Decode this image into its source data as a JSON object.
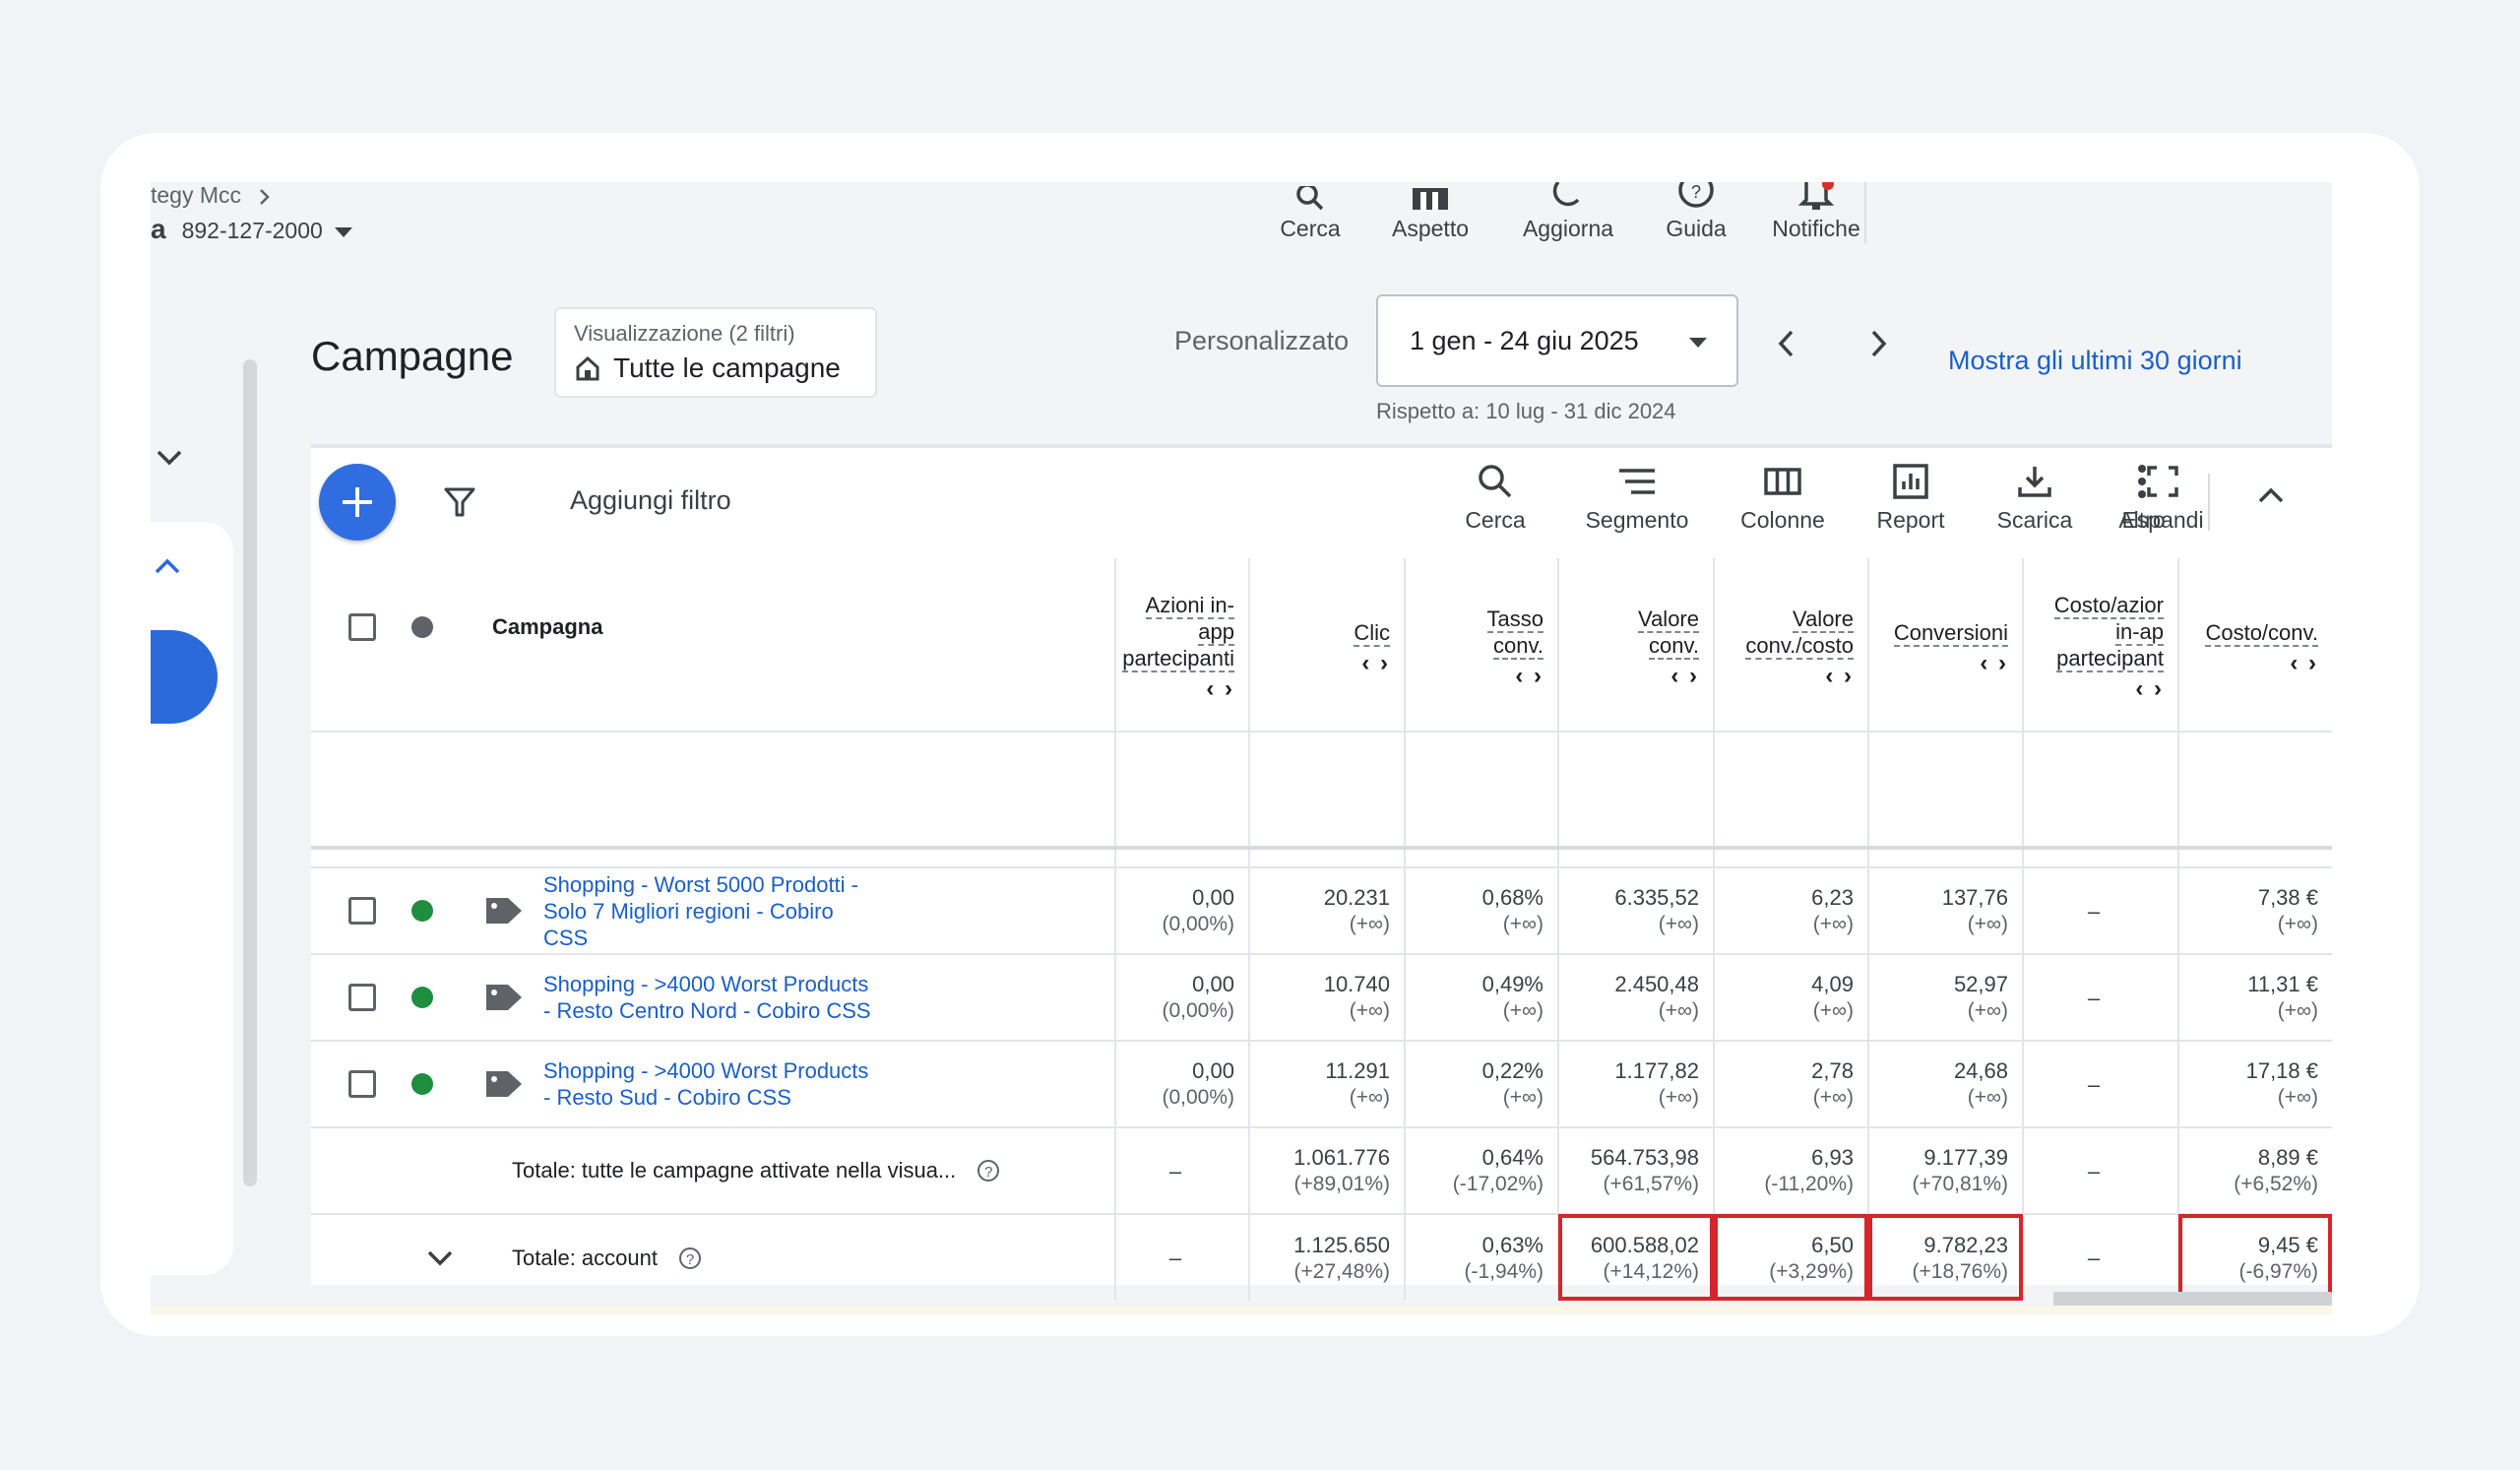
{
  "header": {
    "breadcrumb": "tegy Mcc",
    "account_prefix": "a",
    "account_id": "892-127-2000",
    "top_actions": [
      {
        "label": "Cerca",
        "icon": "search-icon"
      },
      {
        "label": "Aspetto",
        "icon": "appearance-icon"
      },
      {
        "label": "Aggiorna",
        "icon": "refresh-icon"
      },
      {
        "label": "Guida",
        "icon": "help-icon"
      },
      {
        "label": "Notifiche",
        "icon": "bell-icon"
      }
    ]
  },
  "page": {
    "title": "Campagne",
    "view": {
      "caption": "Visualizzazione (2 filtri)",
      "value": "Tutte le campagne"
    },
    "date_mode": "Personalizzato",
    "date_range": "1 gen - 24 giu 2025",
    "compare": "Rispetto a: 10 lug - 31 dic 2024",
    "last30": "Mostra gli ultimi 30 giorni"
  },
  "toolbar": {
    "add_filter": "Aggiungi filtro",
    "buttons": [
      {
        "label": "Cerca",
        "icon": "search-icon"
      },
      {
        "label": "Segmento",
        "icon": "segment-icon"
      },
      {
        "label": "Colonne",
        "icon": "columns-icon"
      },
      {
        "label": "Report",
        "icon": "report-icon"
      },
      {
        "label": "Scarica",
        "icon": "download-icon"
      },
      {
        "label": "Espandi",
        "icon": "expand-icon"
      },
      {
        "label": "Altro",
        "icon": "more-vert-icon"
      }
    ]
  },
  "table": {
    "campaign_header": "Campagna",
    "columns": [
      {
        "l1": "Azioni in-",
        "l2": "app",
        "l3": "partecipanti"
      },
      {
        "l1": "Clic"
      },
      {
        "l1": "Tasso",
        "l2": "conv."
      },
      {
        "l1": "Valore",
        "l2": "conv."
      },
      {
        "l1": "Valore",
        "l2": "conv./costo"
      },
      {
        "l1": "Conversioni"
      },
      {
        "l1": "Costo/azior",
        "l2": "in-ap",
        "l3": "partecipant"
      },
      {
        "l1": "Costo/conv."
      }
    ],
    "sort_arrows": "‹ ›",
    "rows": [
      {
        "name": "Shopping - Worst 5000 Prodotti - Solo 7 Migliori regioni - Cobiro CSS",
        "status_color": "#1e8e3e",
        "cells": [
          {
            "v": "0,00",
            "d": "(0,00%)"
          },
          {
            "v": "20.231",
            "d": "(+∞)"
          },
          {
            "v": "0,68%",
            "d": "(+∞)"
          },
          {
            "v": "6.335,52",
            "d": "(+∞)"
          },
          {
            "v": "6,23",
            "d": "(+∞)"
          },
          {
            "v": "137,76",
            "d": "(+∞)"
          },
          {
            "v": "–",
            "d": ""
          },
          {
            "v": "7,38 €",
            "d": "(+∞)"
          }
        ]
      },
      {
        "name": "Shopping - >4000 Worst Products - Resto Centro Nord - Cobiro CSS",
        "status_color": "#1e8e3e",
        "cells": [
          {
            "v": "0,00",
            "d": "(0,00%)"
          },
          {
            "v": "10.740",
            "d": "(+∞)"
          },
          {
            "v": "0,49%",
            "d": "(+∞)"
          },
          {
            "v": "2.450,48",
            "d": "(+∞)"
          },
          {
            "v": "4,09",
            "d": "(+∞)"
          },
          {
            "v": "52,97",
            "d": "(+∞)"
          },
          {
            "v": "–",
            "d": ""
          },
          {
            "v": "11,31 €",
            "d": "(+∞)"
          }
        ]
      },
      {
        "name": "Shopping - >4000 Worst Products - Resto Sud - Cobiro CSS",
        "status_color": "#1e8e3e",
        "cells": [
          {
            "v": "0,00",
            "d": "(0,00%)"
          },
          {
            "v": "11.291",
            "d": "(+∞)"
          },
          {
            "v": "0,22%",
            "d": "(+∞)"
          },
          {
            "v": "1.177,82",
            "d": "(+∞)"
          },
          {
            "v": "2,78",
            "d": "(+∞)"
          },
          {
            "v": "24,68",
            "d": "(+∞)"
          },
          {
            "v": "–",
            "d": ""
          },
          {
            "v": "17,18 €",
            "d": "(+∞)"
          }
        ]
      }
    ],
    "totals": [
      {
        "label": "Totale: tutte le campagne attivate nella visua...",
        "cells": [
          {
            "v": "–",
            "d": ""
          },
          {
            "v": "1.061.776",
            "d": "(+89,01%)"
          },
          {
            "v": "0,64%",
            "d": "(-17,02%)"
          },
          {
            "v": "564.753,98",
            "d": "(+61,57%)"
          },
          {
            "v": "6,93",
            "d": "(-11,20%)"
          },
          {
            "v": "9.177,39",
            "d": "(+70,81%)"
          },
          {
            "v": "–",
            "d": ""
          },
          {
            "v": "8,89 €",
            "d": "(+6,52%)"
          }
        ]
      },
      {
        "label": "Totale: account",
        "cells": [
          {
            "v": "–",
            "d": ""
          },
          {
            "v": "1.125.650",
            "d": "(+27,48%)"
          },
          {
            "v": "0,63%",
            "d": "(-1,94%)"
          },
          {
            "v": "600.588,02",
            "d": "(+14,12%)"
          },
          {
            "v": "6,50",
            "d": "(+3,29%)"
          },
          {
            "v": "9.782,23",
            "d": "(+18,76%)"
          },
          {
            "v": "–",
            "d": ""
          },
          {
            "v": "9,45 €",
            "d": "(-6,97%)"
          }
        ]
      }
    ]
  },
  "colors": {
    "accent": "#1a5fc8",
    "fab": "#2f6de0",
    "highlight": "#d4262b",
    "status_active": "#1e8e3e",
    "status_header": "#5f6368"
  }
}
